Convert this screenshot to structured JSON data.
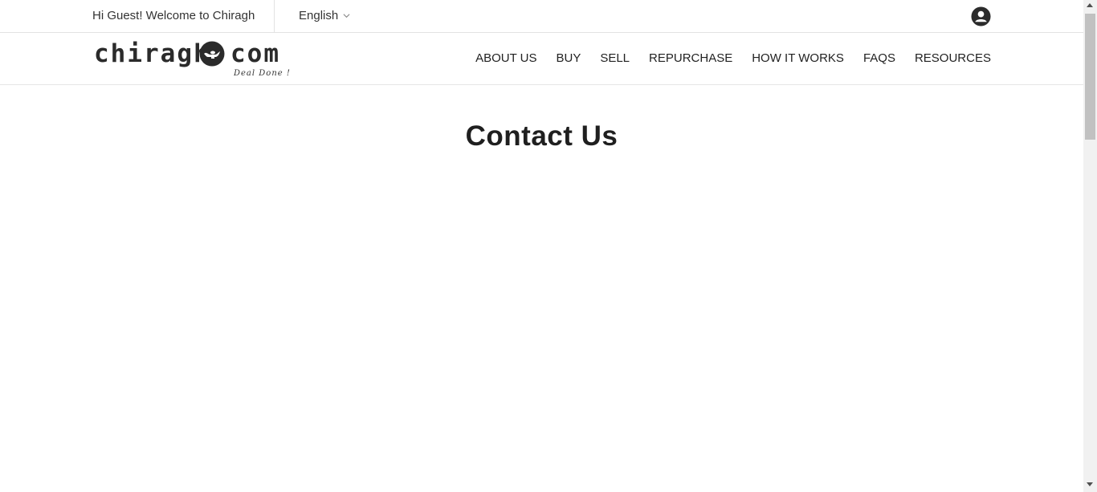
{
  "topbar": {
    "welcome_text": "Hi Guest! Welcome to Chiragh",
    "language_label": "English",
    "language_icon": "chevron-down-icon",
    "user_icon": "user-account-icon"
  },
  "logo": {
    "word_left": "chiragh",
    "word_right": "com",
    "tagline": "Deal Done !",
    "lamp_icon": "magic-lamp-icon"
  },
  "nav": {
    "items": [
      {
        "label": "ABOUT US"
      },
      {
        "label": "BUY"
      },
      {
        "label": "SELL"
      },
      {
        "label": "REPURCHASE"
      },
      {
        "label": "HOW IT WORKS"
      },
      {
        "label": "FAQS"
      },
      {
        "label": "RESOURCES"
      }
    ]
  },
  "main": {
    "title": "Contact Us"
  },
  "colors": {
    "text": "#222222",
    "border": "#e2e2e2",
    "icon": "#2b2b2b"
  }
}
